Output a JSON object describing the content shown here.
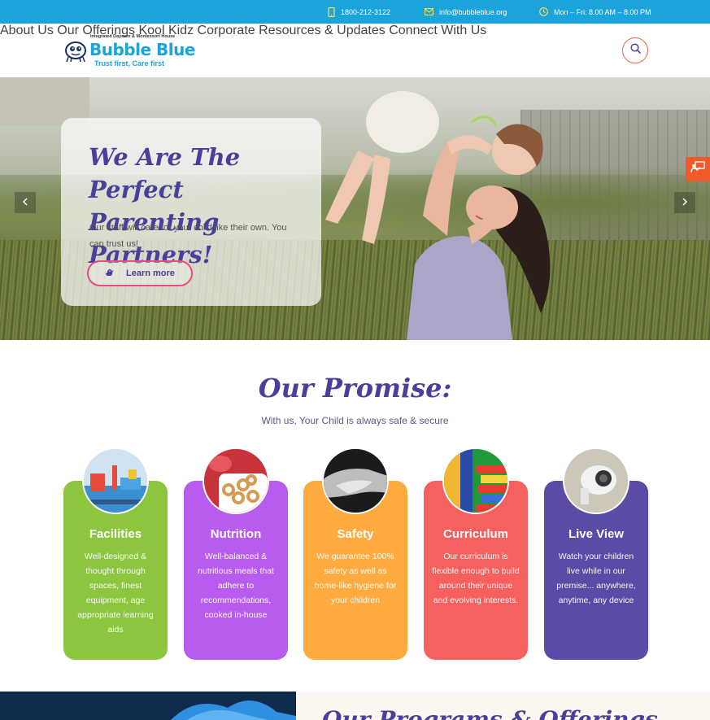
{
  "topbar": {
    "phone": "1800-212-3122",
    "email": "info@bubbleblue.org",
    "hours": "Mon – Fri: 8.00 AM – 8.00 PM",
    "bg_color": "#1ba3dc"
  },
  "logo": {
    "tagline_top": "Integrated Daycare & Montessori House",
    "brand": "Bubble Blue",
    "tagline": "Trust first, Care first"
  },
  "nav": {
    "items": [
      "About Us",
      "Our Offerings",
      "Kool Kidz",
      "Corporate",
      "Resources & Updates",
      "Connect With Us"
    ],
    "search_icon": "search-icon"
  },
  "hero": {
    "title": "We Are The Perfect Parenting Partners!",
    "text": "Our staff will care for your child like their own. You can trust us!",
    "button_label": "Learn more",
    "prev_icon": "chevron-left-icon",
    "next_icon": "chevron-right-icon"
  },
  "promise": {
    "title": "Our Promise:",
    "subtitle": "With us, Your Child is always safe & secure",
    "cards": [
      {
        "title": "Facilities",
        "desc": "Well-designed & thought through spaces, finest equipment, age appropriate learning aids",
        "color": "#8cc63f"
      },
      {
        "title": "Nutrition",
        "desc": "Well-balanced & nutritious meals that adhere to recommendations, cooked in-house",
        "color": "#b85cf0"
      },
      {
        "title": "Safety",
        "desc": "We guarantee 100% safety as well as home-like hygiene for your children",
        "color": "#ffab40"
      },
      {
        "title": "Curriculum",
        "desc": "Our curriculum is flexible enough to build around their unique and evolving interests.",
        "color": "#f6605e"
      },
      {
        "title": "Live View",
        "desc": "Watch your children live while in our premise... anywhere, anytime, any device",
        "color": "#5b4aa6"
      }
    ]
  },
  "bottom": {
    "heading": "Our Programs & Offerings"
  }
}
